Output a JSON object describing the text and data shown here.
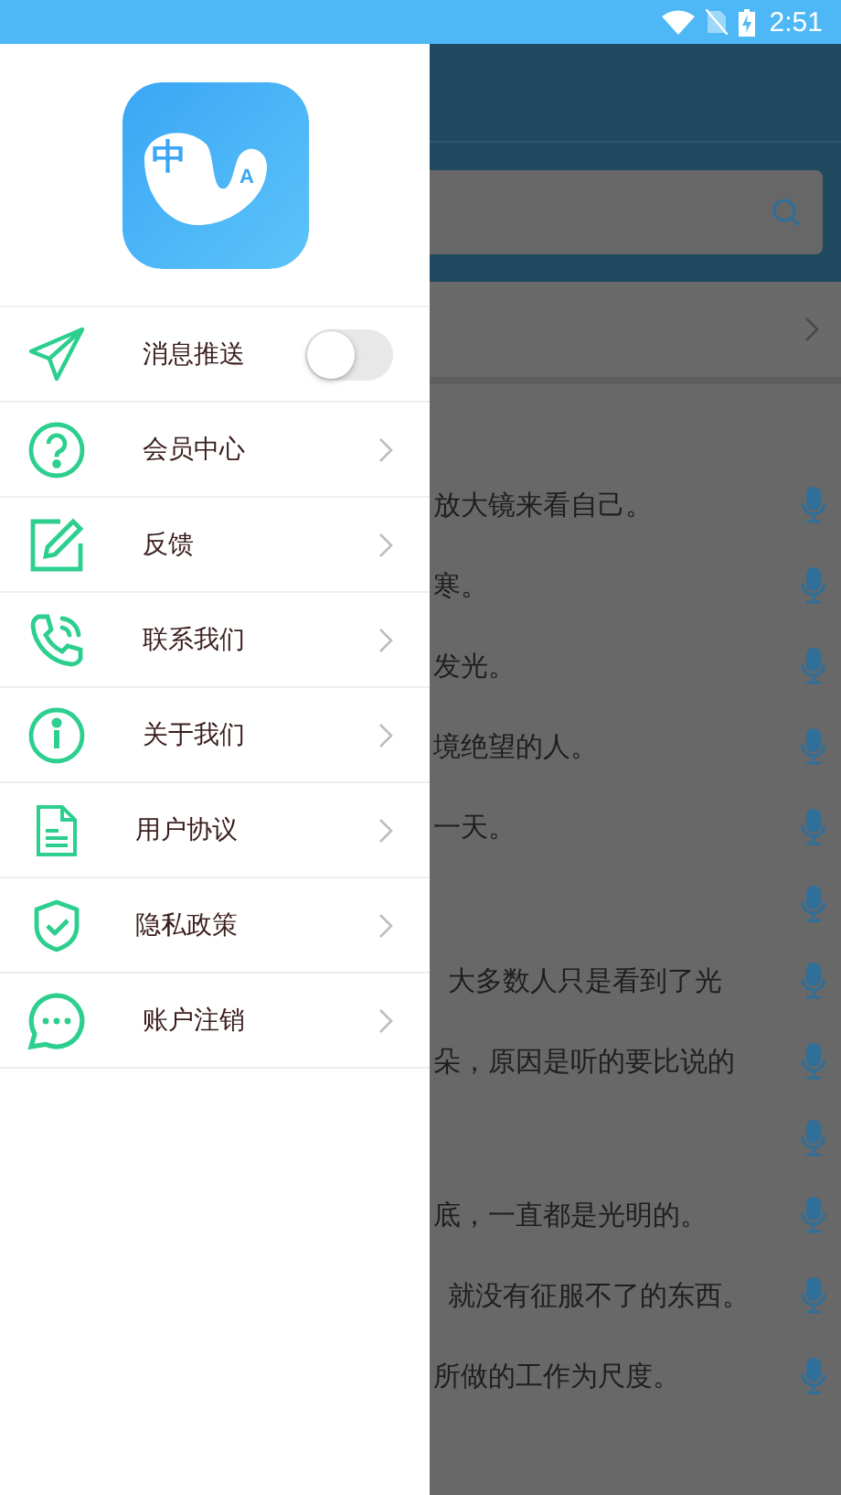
{
  "status_bar": {
    "time": "2:51"
  },
  "drawer": {
    "logo": {
      "left_glyph": "中",
      "right_glyph": "A"
    },
    "menu": [
      {
        "kind": "toggle",
        "label": "消息推送",
        "on": false
      },
      {
        "kind": "link",
        "label": "会员中心"
      },
      {
        "kind": "link",
        "label": "反馈"
      },
      {
        "kind": "link",
        "label": "联系我们"
      },
      {
        "kind": "link",
        "label": "关于我们"
      },
      {
        "kind": "link",
        "label": "用户协议"
      },
      {
        "kind": "link",
        "label": "隐私政策"
      },
      {
        "kind": "link",
        "label": "账户注销"
      }
    ]
  },
  "background": {
    "sentences": [
      {
        "text": "放大镜来看自己。"
      },
      {
        "text": "寒。"
      },
      {
        "text": "发光。"
      },
      {
        "text": "境绝望的人。"
      },
      {
        "text": "一天。"
      },
      {
        "kind": "mic_only"
      },
      {
        "text": "大多数人只是看到了光"
      },
      {
        "text": "朵，原因是听的要比说的"
      },
      {
        "kind": "mic_only"
      },
      {
        "text": "底，一直都是光明的。"
      },
      {
        "text": "就没有征服不了的东西。"
      },
      {
        "text": "所做的工作为尺度。"
      }
    ]
  }
}
